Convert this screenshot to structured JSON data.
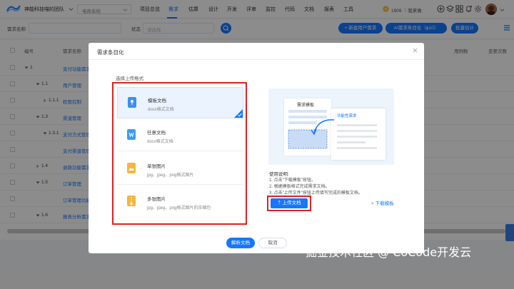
{
  "topbar": {
    "team_name": "神能科技喵的团队",
    "project": "电商系统",
    "menu": [
      "项目总览",
      "需求",
      "估算",
      "设计",
      "开发",
      "评审",
      "监控",
      "代码",
      "文档",
      "报表",
      "工具"
    ],
    "active_menu": "需求",
    "coins": "1909",
    "user": "我来做"
  },
  "filter": {
    "req_name_label": "需求名称",
    "status_label": "状态",
    "status_placeholder": "请选择",
    "new_user_req": "+ 新建用户需求",
    "ai_req": "AI需求条目化（ϕ10）",
    "estimate": "批量估计"
  },
  "table": {
    "headers": [
      "编号",
      "需求名称",
      "用例数",
      "变更次数"
    ],
    "rows": [
      {
        "num": "1",
        "name": "支付功能需求",
        "level": 0,
        "expanded": true
      },
      {
        "num": "1.1",
        "name": "用户管理",
        "level": 1,
        "expanded": true
      },
      {
        "num": "1.1.1",
        "name": "权限控制",
        "level": 2,
        "expanded": false
      },
      {
        "num": "1.3",
        "name": "渠道管理",
        "level": 1,
        "expanded": true
      },
      {
        "num": "1.3.1",
        "name": "支付方式管理",
        "level": 2,
        "expanded": true
      },
      {
        "num": "",
        "name": "支付渠道管理",
        "level": 3,
        "expanded": false
      },
      {
        "num": "1.4",
        "name": "退款功能需求",
        "level": 1,
        "expanded": false
      },
      {
        "num": "1.5",
        "name": "订单管理",
        "level": 1,
        "expanded": true
      },
      {
        "num": "",
        "name": "订单管理功能",
        "level": 3,
        "expanded": false
      },
      {
        "num": "1.6",
        "name": "报表分析需求",
        "level": 1,
        "expanded": true
      }
    ]
  },
  "modal": {
    "title": "需求条目化",
    "select_label": "选择上传格式",
    "options": [
      {
        "title": "模板文档",
        "desc": "docx格式文档",
        "icon": "template-doc-icon",
        "color": "#3b8ff0",
        "selected": true
      },
      {
        "title": "任意文档",
        "desc": "docx格式文档",
        "icon": "word-doc-icon",
        "color": "#3b9cf5",
        "selected": false
      },
      {
        "title": "单张图片",
        "desc": "jpg、jpeg、png格式图片",
        "icon": "image-icon",
        "color": "#f5b63b",
        "selected": false
      },
      {
        "title": "多张图片",
        "desc": "jpg、jpeg、png格式图片的压缩包",
        "icon": "zip-icon",
        "color": "#f5b63b",
        "selected": false
      }
    ],
    "illus_doc_title": "需求模板",
    "illus_tag": "功能性需求",
    "usage_title": "使用说明:",
    "usage_lines": [
      "1. 点击\"下载模板\"按钮。",
      "2. 根据模板格式完成需求文档。",
      "3. 点击\"上传文件\"按钮上传填写完成的模板文档。"
    ],
    "upload_btn": "上传文档",
    "download_link": "下载模板",
    "parse_btn": "解析文档",
    "cancel_btn": "取消"
  },
  "watermark": "掘金技术社区 @ CoCode开发云"
}
